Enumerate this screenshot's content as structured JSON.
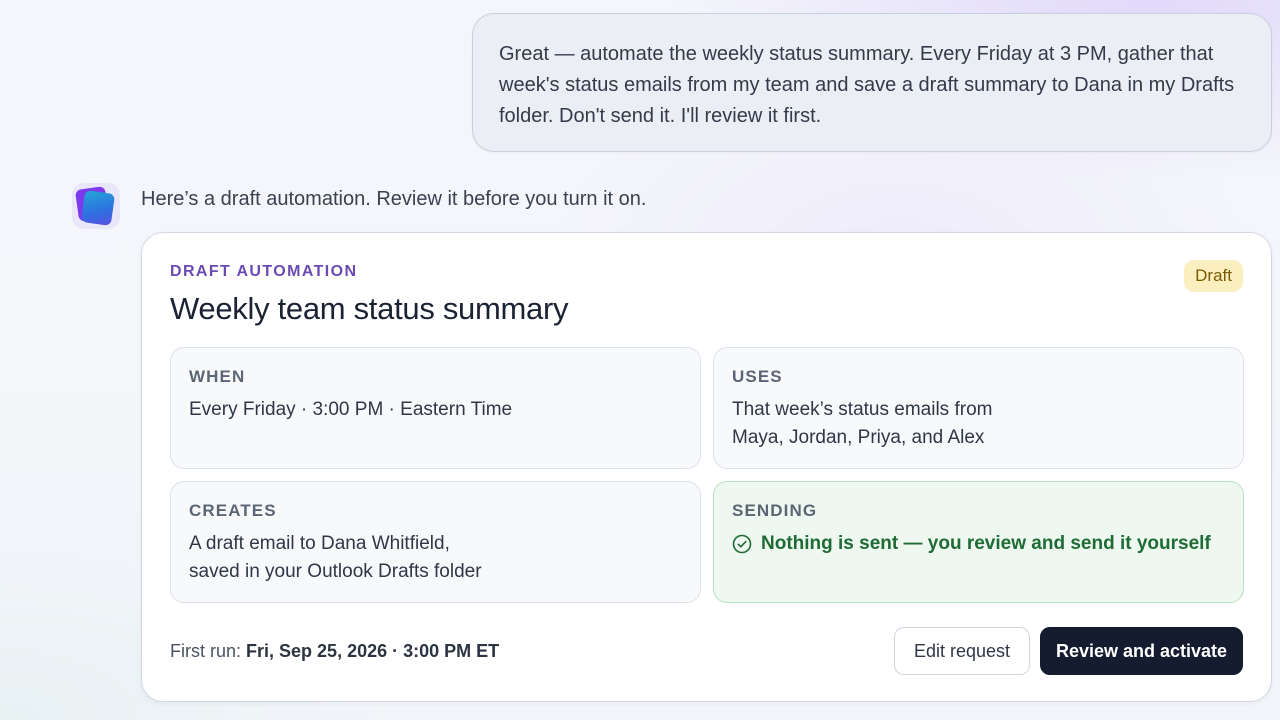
{
  "user_message": {
    "text": "Great — automate the weekly status summary. Every Friday at 3 PM, gather that week's status emails from my team and save a draft summary to Dana in my Drafts folder. Don't send it. I'll review it first."
  },
  "assistant": {
    "intro": "Here’s a draft automation. Review it before you turn it on."
  },
  "card": {
    "eyebrow": "DRAFT AUTOMATION",
    "title": "Weekly team status summary",
    "badge": "Draft",
    "when": {
      "label": "WHEN",
      "text": "Every Friday · 3:00 PM · Eastern Time"
    },
    "uses": {
      "label": "USES",
      "line1": "That week’s status emails from",
      "line2": "Maya, Jordan, Priya, and Alex"
    },
    "creates": {
      "label": "CREATES",
      "line1": "A draft email to Dana Whitfield,",
      "line2": "saved in your Outlook Drafts folder"
    },
    "sending": {
      "label": "SENDING",
      "text": "Nothing is sent — you review and send it yourself",
      "icon": "check-circle-icon"
    },
    "first_run": {
      "label": "First run:",
      "value": "Fri, Sep 25, 2026 · 3:00 PM ET"
    },
    "buttons": {
      "edit": "Edit request",
      "activate": "Review and activate"
    }
  },
  "colors": {
    "accent_purple": "#6b4bb3",
    "badge_bg": "#fbefbf",
    "success_green": "#1f6b35",
    "primary_button": "#151c30"
  }
}
